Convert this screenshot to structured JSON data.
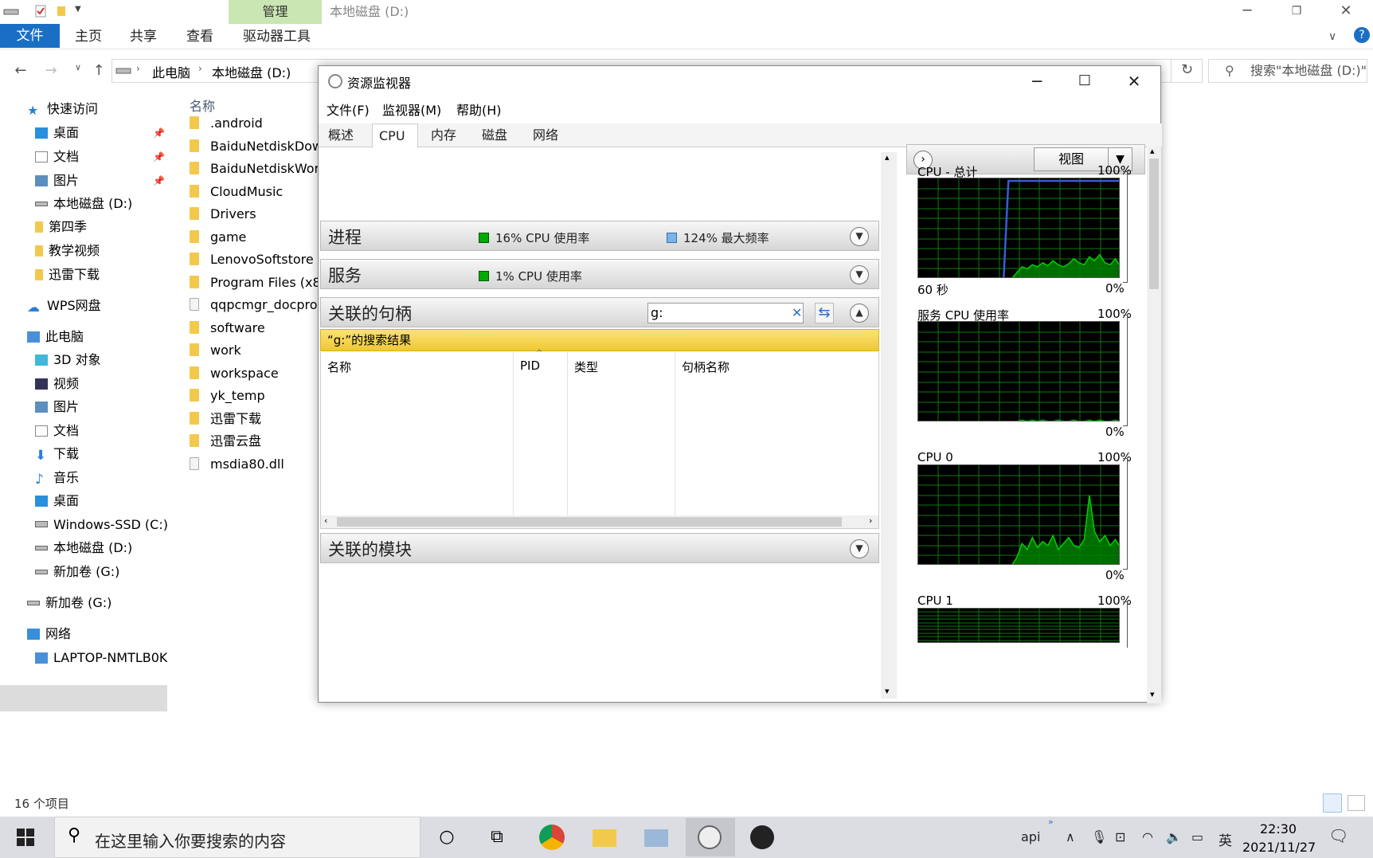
{
  "explorer": {
    "title_tab_manage": "管理",
    "window_title": "本地磁盘 (D:)",
    "ribbon": {
      "file": "文件",
      "home": "主页",
      "share": "共享",
      "view": "查看",
      "drive_tools": "驱动器工具"
    },
    "address": {
      "part1": "此电脑",
      "part2": "本地磁盘 (D:)"
    },
    "search_placeholder": "搜索\"本地磁盘 (D:)\"",
    "nav": {
      "quick_access": "快速访问",
      "desktop": "桌面",
      "documents": "文档",
      "pictures": "图片",
      "local_d": "本地磁盘 (D:)",
      "season4": "第四季",
      "teaching_video": "教学视频",
      "xunlei": "迅雷下载",
      "wps": "WPS网盘",
      "this_pc": "此电脑",
      "objects3d": "3D 对象",
      "videos": "视频",
      "pictures2": "图片",
      "documents2": "文档",
      "downloads": "下载",
      "music": "音乐",
      "desktop2": "桌面",
      "windows_ssd": "Windows-SSD (C:)",
      "local_d2": "本地磁盘 (D:)",
      "new_vol_g": "新加卷 (G:)",
      "new_vol_g2": "新加卷 (G:)",
      "network": "网络",
      "laptop": "LAPTOP-NMTLB0K"
    },
    "column_name": "名称",
    "files": [
      ".android",
      "BaiduNetdiskDow",
      "BaiduNetdiskWor",
      "CloudMusic",
      "Drivers",
      "game",
      "LenovoSoftstore",
      "Program Files (x8",
      "qqpcmgr_docpro",
      "software",
      "work",
      "workspace",
      "yk_temp",
      "迅雷下载",
      "迅雷云盘",
      "msdia80.dll"
    ],
    "status": "16 个项目"
  },
  "resmon": {
    "title": "资源监视器",
    "menu": {
      "file": "文件(F)",
      "monitor": "监视器(M)",
      "help": "帮助(H)"
    },
    "tabs": {
      "overview": "概述",
      "cpu": "CPU",
      "memory": "内存",
      "disk": "磁盘",
      "network": "网络"
    },
    "process": {
      "title": "进程",
      "cpu_usage": "16% CPU 使用率",
      "max_freq": "124% 最大频率"
    },
    "services": {
      "title": "服务",
      "cpu_usage": "1% CPU 使用率"
    },
    "handles": {
      "title": "关联的句柄",
      "search_value": "g:",
      "results": "“g:”的搜索结果",
      "col_name": "名称",
      "col_pid": "PID",
      "col_type": "类型",
      "col_handle": "句柄名称"
    },
    "modules": {
      "title": "关联的模块"
    },
    "view_button": "视图",
    "graphs": {
      "cpu_total": "CPU - 总计",
      "pct100": "100%",
      "pct0": "0%",
      "sec60": "60 秒",
      "service_cpu": "服务 CPU 使用率",
      "cpu0": "CPU 0",
      "cpu1": "CPU 1"
    },
    "colors": {
      "graph_bg": "#000000",
      "grid": "#0b7a0b",
      "line": "#00d000",
      "fill": "#008000",
      "freq": "#3a5bd9"
    }
  },
  "taskbar": {
    "search_text": "在这里输入你要搜索的内容",
    "tray_api": "api",
    "tray_lang": "英",
    "time": "22:30",
    "date": "2021/11/27"
  }
}
